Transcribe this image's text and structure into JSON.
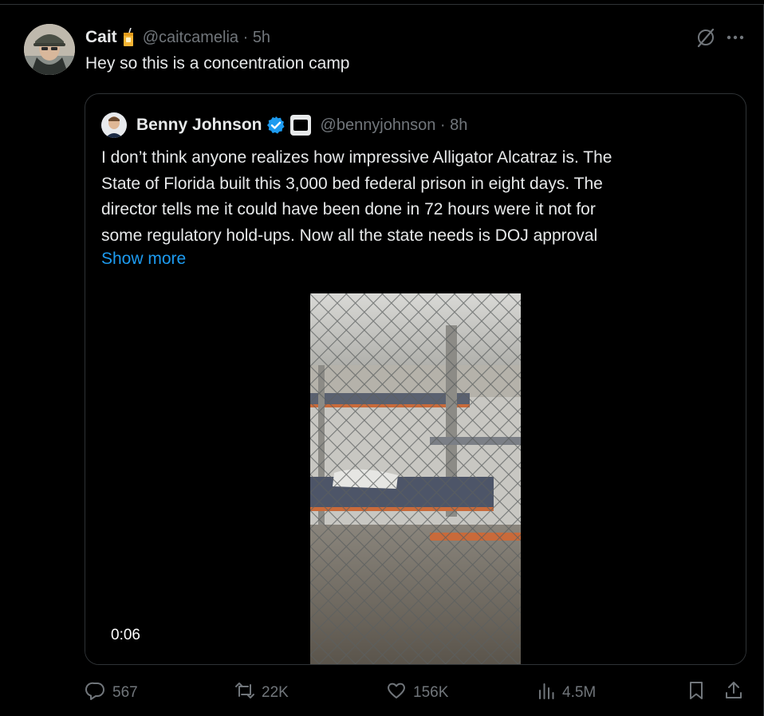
{
  "post": {
    "author_name": "Cait",
    "handle": "@caitcamelia",
    "time": "5h",
    "text": "Hey so this is a concentration camp",
    "emoji_icon": "juice-box-icon"
  },
  "quote": {
    "author_name": "Benny Johnson",
    "handle": "@bennyjohnson",
    "time": "8h",
    "text_lines": [
      "I don’t think anyone realizes how impressive Alligator Alcatraz is. The",
      "State of Florida built this 3,000 bed federal prison in eight days. The",
      "director tells me it could have been done in 72 hours were it not for",
      "some regulatory hold-ups. Now all the state needs is DOJ approval"
    ],
    "show_more": "Show more",
    "video_time": "0:06"
  },
  "actions": {
    "replies": "567",
    "reposts": "22K",
    "likes": "156K",
    "views": "4.5M"
  },
  "colors": {
    "background": "#000000",
    "text": "#e7e9ea",
    "muted": "#71767b",
    "link": "#1d9bf0",
    "border": "#2f3336",
    "verified": "#1d9bf0"
  }
}
